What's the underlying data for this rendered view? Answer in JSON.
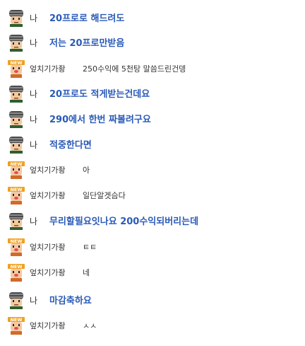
{
  "messages": [
    {
      "who": "me",
      "name": "나",
      "text": "20프로로 해드려도"
    },
    {
      "who": "me",
      "name": "나",
      "text": "저는 20프로만받음"
    },
    {
      "who": "other",
      "name": "엎치기가좡",
      "text": "250수익에 5천탕 말씀드린건뎅"
    },
    {
      "who": "me",
      "name": "나",
      "text": "20프로도 적게받는건데요"
    },
    {
      "who": "me",
      "name": "나",
      "text": "290에서 한번 짜볼려구요"
    },
    {
      "who": "me",
      "name": "나",
      "text": "적중한다면"
    },
    {
      "who": "other",
      "name": "엎치기가좡",
      "text": "아"
    },
    {
      "who": "other",
      "name": "엎치기가좡",
      "text": "일단알겟슴다"
    },
    {
      "who": "me",
      "name": "나",
      "text": "무리할필요잇나요 200수익되버리는데"
    },
    {
      "who": "other",
      "name": "엎치기가좡",
      "text": "ㅌㅌ"
    },
    {
      "who": "other",
      "name": "엎치기가좡",
      "text": "네"
    },
    {
      "who": "me",
      "name": "나",
      "text": "마감축하요"
    },
    {
      "who": "other",
      "name": "엎치기가좡",
      "text": "ㅅㅅ"
    }
  ],
  "icons": {
    "me": "helmet-character-icon",
    "other": "new-badge-character-icon"
  },
  "colors": {
    "my_text": "#2a5ab8",
    "other_text": "#333333"
  }
}
